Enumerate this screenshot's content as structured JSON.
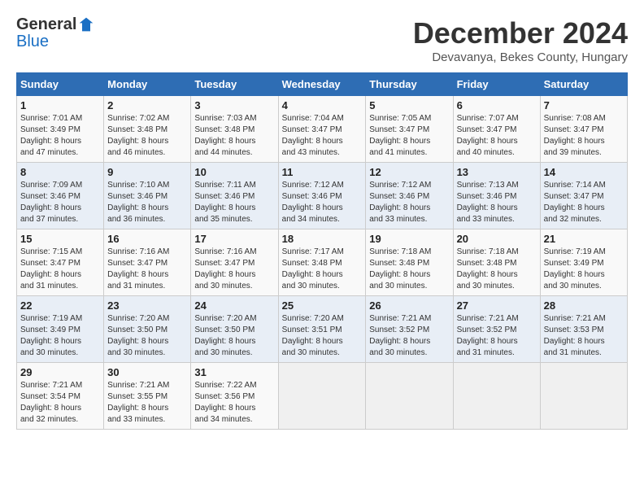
{
  "header": {
    "logo_general": "General",
    "logo_blue": "Blue",
    "month_title": "December 2024",
    "location": "Devavanya, Bekes County, Hungary"
  },
  "days_of_week": [
    "Sunday",
    "Monday",
    "Tuesday",
    "Wednesday",
    "Thursday",
    "Friday",
    "Saturday"
  ],
  "weeks": [
    [
      {
        "day": "1",
        "sunrise": "7:01 AM",
        "sunset": "3:49 PM",
        "daylight": "8 hours and 47 minutes."
      },
      {
        "day": "2",
        "sunrise": "7:02 AM",
        "sunset": "3:48 PM",
        "daylight": "8 hours and 46 minutes."
      },
      {
        "day": "3",
        "sunrise": "7:03 AM",
        "sunset": "3:48 PM",
        "daylight": "8 hours and 44 minutes."
      },
      {
        "day": "4",
        "sunrise": "7:04 AM",
        "sunset": "3:47 PM",
        "daylight": "8 hours and 43 minutes."
      },
      {
        "day": "5",
        "sunrise": "7:05 AM",
        "sunset": "3:47 PM",
        "daylight": "8 hours and 41 minutes."
      },
      {
        "day": "6",
        "sunrise": "7:07 AM",
        "sunset": "3:47 PM",
        "daylight": "8 hours and 40 minutes."
      },
      {
        "day": "7",
        "sunrise": "7:08 AM",
        "sunset": "3:47 PM",
        "daylight": "8 hours and 39 minutes."
      }
    ],
    [
      {
        "day": "8",
        "sunrise": "7:09 AM",
        "sunset": "3:46 PM",
        "daylight": "8 hours and 37 minutes."
      },
      {
        "day": "9",
        "sunrise": "7:10 AM",
        "sunset": "3:46 PM",
        "daylight": "8 hours and 36 minutes."
      },
      {
        "day": "10",
        "sunrise": "7:11 AM",
        "sunset": "3:46 PM",
        "daylight": "8 hours and 35 minutes."
      },
      {
        "day": "11",
        "sunrise": "7:12 AM",
        "sunset": "3:46 PM",
        "daylight": "8 hours and 34 minutes."
      },
      {
        "day": "12",
        "sunrise": "7:12 AM",
        "sunset": "3:46 PM",
        "daylight": "8 hours and 33 minutes."
      },
      {
        "day": "13",
        "sunrise": "7:13 AM",
        "sunset": "3:46 PM",
        "daylight": "8 hours and 33 minutes."
      },
      {
        "day": "14",
        "sunrise": "7:14 AM",
        "sunset": "3:47 PM",
        "daylight": "8 hours and 32 minutes."
      }
    ],
    [
      {
        "day": "15",
        "sunrise": "7:15 AM",
        "sunset": "3:47 PM",
        "daylight": "8 hours and 31 minutes."
      },
      {
        "day": "16",
        "sunrise": "7:16 AM",
        "sunset": "3:47 PM",
        "daylight": "8 hours and 31 minutes."
      },
      {
        "day": "17",
        "sunrise": "7:16 AM",
        "sunset": "3:47 PM",
        "daylight": "8 hours and 30 minutes."
      },
      {
        "day": "18",
        "sunrise": "7:17 AM",
        "sunset": "3:48 PM",
        "daylight": "8 hours and 30 minutes."
      },
      {
        "day": "19",
        "sunrise": "7:18 AM",
        "sunset": "3:48 PM",
        "daylight": "8 hours and 30 minutes."
      },
      {
        "day": "20",
        "sunrise": "7:18 AM",
        "sunset": "3:48 PM",
        "daylight": "8 hours and 30 minutes."
      },
      {
        "day": "21",
        "sunrise": "7:19 AM",
        "sunset": "3:49 PM",
        "daylight": "8 hours and 30 minutes."
      }
    ],
    [
      {
        "day": "22",
        "sunrise": "7:19 AM",
        "sunset": "3:49 PM",
        "daylight": "8 hours and 30 minutes."
      },
      {
        "day": "23",
        "sunrise": "7:20 AM",
        "sunset": "3:50 PM",
        "daylight": "8 hours and 30 minutes."
      },
      {
        "day": "24",
        "sunrise": "7:20 AM",
        "sunset": "3:50 PM",
        "daylight": "8 hours and 30 minutes."
      },
      {
        "day": "25",
        "sunrise": "7:20 AM",
        "sunset": "3:51 PM",
        "daylight": "8 hours and 30 minutes."
      },
      {
        "day": "26",
        "sunrise": "7:21 AM",
        "sunset": "3:52 PM",
        "daylight": "8 hours and 30 minutes."
      },
      {
        "day": "27",
        "sunrise": "7:21 AM",
        "sunset": "3:52 PM",
        "daylight": "8 hours and 31 minutes."
      },
      {
        "day": "28",
        "sunrise": "7:21 AM",
        "sunset": "3:53 PM",
        "daylight": "8 hours and 31 minutes."
      }
    ],
    [
      {
        "day": "29",
        "sunrise": "7:21 AM",
        "sunset": "3:54 PM",
        "daylight": "8 hours and 32 minutes."
      },
      {
        "day": "30",
        "sunrise": "7:21 AM",
        "sunset": "3:55 PM",
        "daylight": "8 hours and 33 minutes."
      },
      {
        "day": "31",
        "sunrise": "7:22 AM",
        "sunset": "3:56 PM",
        "daylight": "8 hours and 34 minutes."
      },
      null,
      null,
      null,
      null
    ]
  ],
  "labels": {
    "sunrise": "Sunrise:",
    "sunset": "Sunset:",
    "daylight": "Daylight:"
  }
}
